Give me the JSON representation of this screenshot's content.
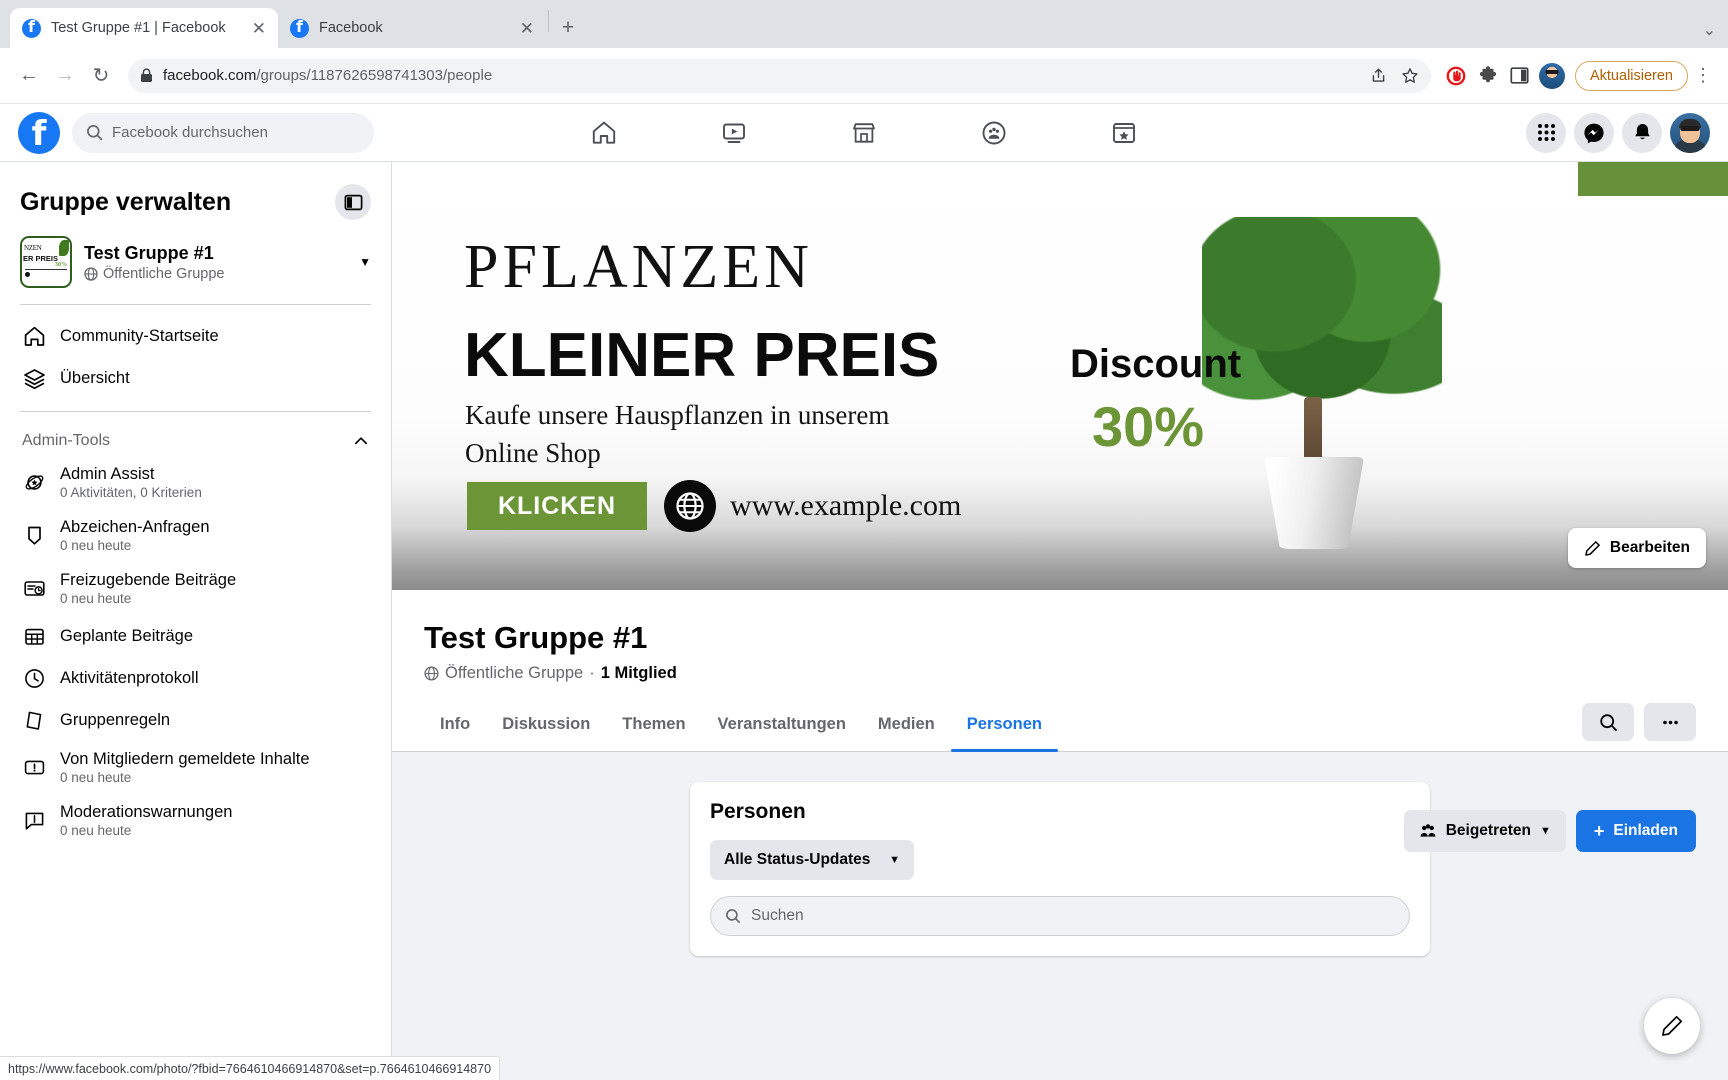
{
  "browser": {
    "tabs": [
      {
        "title": "Test Gruppe #1 | Facebook",
        "favicon": "facebook-favicon",
        "active": true
      },
      {
        "title": "Facebook",
        "favicon": "facebook-favicon",
        "active": false
      }
    ],
    "new_tab_label": "+",
    "tablist_menu_label": "⌄",
    "back_label": "←",
    "forward_label": "→",
    "reload_label": "↻",
    "url_host": "facebook.com",
    "url_path": "/groups/1187626598741303/people",
    "lock_icon": "lock-icon",
    "share_icon": "share-icon",
    "bookmark_icon": "star-icon",
    "adblock_icon": "adblock-icon",
    "extensions_icon": "puzzle-icon",
    "sidepanel_icon": "side-panel-icon",
    "profile_icon": "profile-avatar",
    "update_label": "Aktualisieren",
    "menu_label": "⋮",
    "status_url": "https://www.facebook.com/photo/?fbid=7664610466914870&set=p.7664610466914870"
  },
  "fb_header": {
    "logo": "facebook-logo",
    "search_placeholder": "Facebook durchsuchen",
    "search_icon": "search-icon",
    "nav": [
      {
        "name": "home-icon",
        "label": "Startseite"
      },
      {
        "name": "video-icon",
        "label": "Video"
      },
      {
        "name": "marketplace-icon",
        "label": "Marketplace"
      },
      {
        "name": "groups-icon",
        "label": "Gruppen"
      },
      {
        "name": "gaming-icon",
        "label": "Gaming"
      }
    ],
    "right": [
      {
        "name": "menu-grid-icon"
      },
      {
        "name": "messenger-icon"
      },
      {
        "name": "notifications-icon"
      },
      {
        "name": "account-avatar"
      }
    ]
  },
  "sidebar": {
    "title": "Gruppe verwalten",
    "toggle_icon": "panel-toggle-icon",
    "group": {
      "name": "Test Gruppe #1",
      "privacy": "Öffentliche Gruppe",
      "globe_icon": "globe-icon",
      "chevron_icon": "chevron-down-icon",
      "thumb_text_1": "NZEN",
      "thumb_text_2": "ER PREIS",
      "thumb_text_3": "30%"
    },
    "links": [
      {
        "label": "Community-Startseite",
        "icon": "home-icon"
      },
      {
        "label": "Übersicht",
        "icon": "layers-icon"
      }
    ],
    "section": {
      "title": "Admin-Tools",
      "chevron_icon": "chevron-up-icon"
    },
    "admin_items": [
      {
        "label": "Admin Assist",
        "sub": "0 Aktivitäten, 0 Kriterien",
        "icon": "admin-assist-icon"
      },
      {
        "label": "Abzeichen-Anfragen",
        "sub": "0 neu heute",
        "icon": "badge-icon"
      },
      {
        "label": "Freizugebende Beiträge",
        "sub": "0 neu heute",
        "icon": "pending-posts-icon"
      },
      {
        "label": "Geplante Beiträge",
        "sub": "",
        "icon": "calendar-icon"
      },
      {
        "label": "Aktivitätenprotokoll",
        "sub": "",
        "icon": "clock-icon"
      },
      {
        "label": "Gruppenregeln",
        "sub": "",
        "icon": "rules-icon"
      },
      {
        "label": "Von Mitgliedern gemeldete Inhalte",
        "sub": "0 neu heute",
        "icon": "report-icon"
      },
      {
        "label": "Moderationswarnungen",
        "sub": "0 neu heute",
        "icon": "moderation-alert-icon"
      }
    ]
  },
  "cover": {
    "headline_serif": "PFLANZEN",
    "headline_bold": "KLEINER PREIS",
    "sub_line1": "Kaufe unsere Hauspflanzen in unserem",
    "sub_line2": "Online Shop",
    "cta_label": "KLICKEN",
    "website": "www.example.com",
    "discount_label": "Discount",
    "discount_value": "30%",
    "globe_icon": "globe-icon",
    "edit_label": "Bearbeiten",
    "edit_icon": "pencil-icon",
    "accent_green": "#6b9536"
  },
  "group_header": {
    "title": "Test Gruppe #1",
    "privacy": "Öffentliche Gruppe",
    "separator": "·",
    "members": "1 Mitglied",
    "globe_icon": "globe-icon",
    "joined_label": "Beigetreten",
    "joined_icon": "members-icon",
    "joined_chevron": "chevron-down-icon",
    "invite_label": "Einladen",
    "invite_icon": "plus-icon"
  },
  "tabs": {
    "items": [
      {
        "label": "Info",
        "active": false
      },
      {
        "label": "Diskussion",
        "active": false
      },
      {
        "label": "Themen",
        "active": false
      },
      {
        "label": "Veranstaltungen",
        "active": false
      },
      {
        "label": "Medien",
        "active": false
      },
      {
        "label": "Personen",
        "active": true
      }
    ],
    "search_icon": "search-icon",
    "more_icon": "more-horizontal-icon"
  },
  "people_panel": {
    "title": "Personen",
    "status_filter_label": "Alle Status-Updates",
    "status_filter_chevron": "chevron-down-icon",
    "search_placeholder": "Suchen",
    "search_icon": "search-icon"
  },
  "fab": {
    "icon": "compose-pencil-icon"
  },
  "colors": {
    "fb_blue": "#1b74e4",
    "accent_green": "#6b9536",
    "grey_btn": "#e4e6eb",
    "page_bg": "#f0f2f5"
  }
}
